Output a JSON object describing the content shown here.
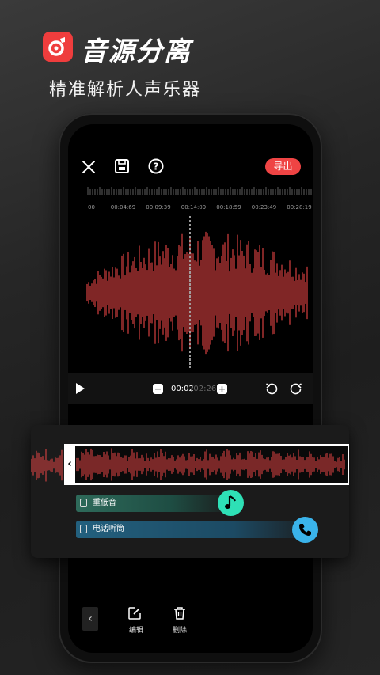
{
  "header": {
    "title": "音源分离",
    "subtitle": "精准解析人声乐器",
    "logo_icon": "music-note-logo-icon",
    "accent": "#ef3d3d"
  },
  "topbar": {
    "close_icon": "close-icon",
    "save_icon": "save-icon",
    "help_icon": "help-icon",
    "export_label": "导出"
  },
  "ruler": {
    "labels": [
      "00",
      "00:04:69",
      "00:09:39",
      "00:14:09",
      "00:18:59",
      "00:23:49",
      "00:28:19"
    ]
  },
  "player": {
    "current_time": "00:02",
    "total_time": "/02:26",
    "minus_label": "−",
    "plus_label": "+",
    "play_icon": "play-icon",
    "undo_icon": "undo-icon",
    "redo_icon": "redo-icon"
  },
  "clip_editor": {
    "handle_label": "‹",
    "tracks": [
      {
        "label": "重低音",
        "icon": "music-note-icon",
        "color": "#2ee0b6"
      },
      {
        "label": "电话听筒",
        "icon": "phone-icon",
        "color": "#3ab3ea"
      }
    ]
  },
  "bottom_bar": {
    "back_label": "‹",
    "edit_label": "编辑",
    "delete_label": "删除"
  }
}
